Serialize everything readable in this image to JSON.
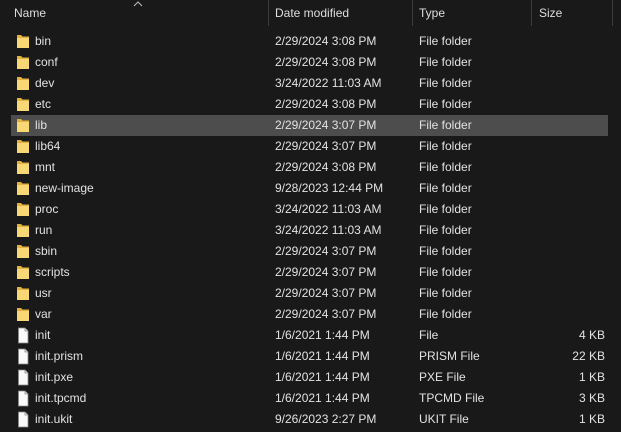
{
  "columns": {
    "name": "Name",
    "date": "Date modified",
    "type": "Type",
    "size": "Size"
  },
  "icons": {
    "folder": "folder-icon",
    "file": "file-icon",
    "sort": "sort-ascending-caret-icon"
  },
  "colors": {
    "folder_yellow": "#f8d775",
    "folder_shade": "#e3b13e",
    "selection": "#4d4d4d",
    "background": "#191919"
  },
  "files": [
    {
      "name": "bin",
      "date": "2/29/2024 3:08 PM",
      "type": "File folder",
      "size": "",
      "kind": "folder",
      "selected": false
    },
    {
      "name": "conf",
      "date": "2/29/2024 3:08 PM",
      "type": "File folder",
      "size": "",
      "kind": "folder",
      "selected": false
    },
    {
      "name": "dev",
      "date": "3/24/2022 11:03 AM",
      "type": "File folder",
      "size": "",
      "kind": "folder",
      "selected": false
    },
    {
      "name": "etc",
      "date": "2/29/2024 3:08 PM",
      "type": "File folder",
      "size": "",
      "kind": "folder",
      "selected": false
    },
    {
      "name": "lib",
      "date": "2/29/2024 3:07 PM",
      "type": "File folder",
      "size": "",
      "kind": "folder",
      "selected": true
    },
    {
      "name": "lib64",
      "date": "2/29/2024 3:07 PM",
      "type": "File folder",
      "size": "",
      "kind": "folder",
      "selected": false
    },
    {
      "name": "mnt",
      "date": "2/29/2024 3:08 PM",
      "type": "File folder",
      "size": "",
      "kind": "folder",
      "selected": false
    },
    {
      "name": "new-image",
      "date": "9/28/2023 12:44 PM",
      "type": "File folder",
      "size": "",
      "kind": "folder",
      "selected": false
    },
    {
      "name": "proc",
      "date": "3/24/2022 11:03 AM",
      "type": "File folder",
      "size": "",
      "kind": "folder",
      "selected": false
    },
    {
      "name": "run",
      "date": "3/24/2022 11:03 AM",
      "type": "File folder",
      "size": "",
      "kind": "folder",
      "selected": false
    },
    {
      "name": "sbin",
      "date": "2/29/2024 3:07 PM",
      "type": "File folder",
      "size": "",
      "kind": "folder",
      "selected": false
    },
    {
      "name": "scripts",
      "date": "2/29/2024 3:07 PM",
      "type": "File folder",
      "size": "",
      "kind": "folder",
      "selected": false
    },
    {
      "name": "usr",
      "date": "2/29/2024 3:07 PM",
      "type": "File folder",
      "size": "",
      "kind": "folder",
      "selected": false
    },
    {
      "name": "var",
      "date": "2/29/2024 3:07 PM",
      "type": "File folder",
      "size": "",
      "kind": "folder",
      "selected": false
    },
    {
      "name": "init",
      "date": "1/6/2021 1:44 PM",
      "type": "File",
      "size": "4 KB",
      "kind": "file",
      "selected": false
    },
    {
      "name": "init.prism",
      "date": "1/6/2021 1:44 PM",
      "type": "PRISM File",
      "size": "22 KB",
      "kind": "file",
      "selected": false
    },
    {
      "name": "init.pxe",
      "date": "1/6/2021 1:44 PM",
      "type": "PXE File",
      "size": "1 KB",
      "kind": "file",
      "selected": false
    },
    {
      "name": "init.tpcmd",
      "date": "1/6/2021 1:44 PM",
      "type": "TPCMD File",
      "size": "3 KB",
      "kind": "file",
      "selected": false
    },
    {
      "name": "init.ukit",
      "date": "9/26/2023 2:27 PM",
      "type": "UKIT File",
      "size": "1 KB",
      "kind": "file",
      "selected": false
    }
  ]
}
